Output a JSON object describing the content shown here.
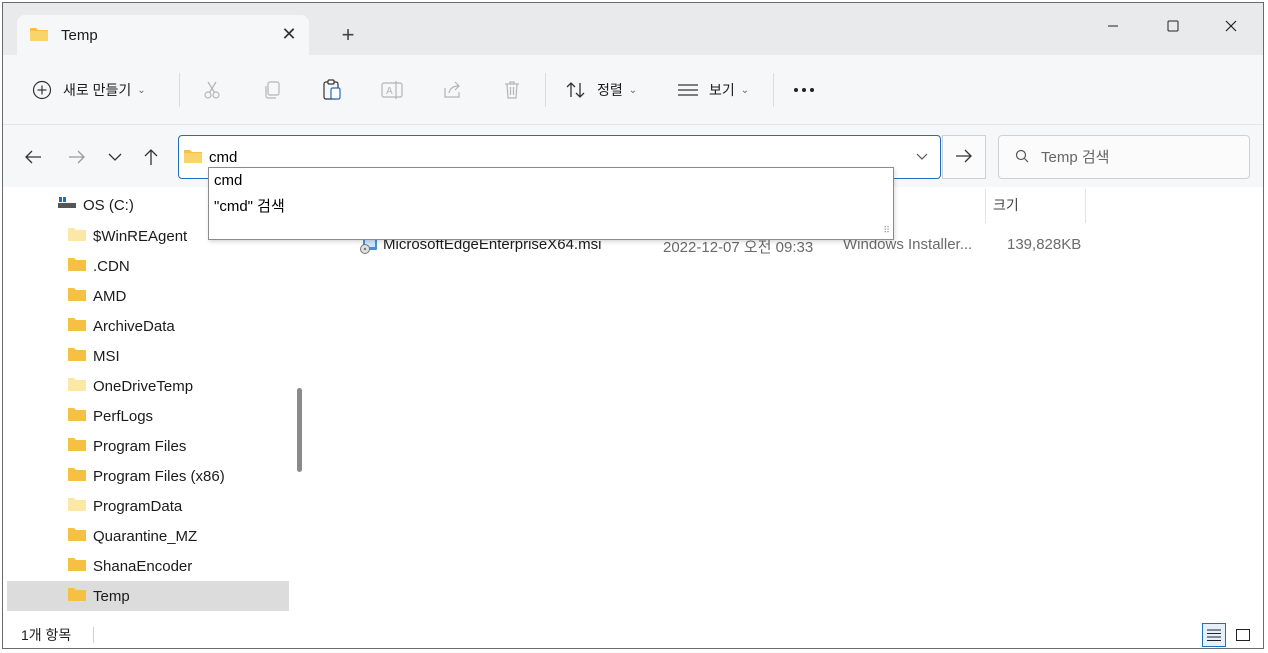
{
  "colors": {
    "accent": "#1f6fbf",
    "folder": "#f6c143",
    "folder_light": "#fbe7a6",
    "selected_bg": "#dcdcdc",
    "titlebar_bg": "#e9eaec"
  },
  "tab": {
    "title": "Temp",
    "close_icon": "close-icon",
    "new_tab_icon": "plus-icon"
  },
  "window_controls": {
    "minimize": "minimize-icon",
    "maximize": "maximize-icon",
    "close": "close-icon"
  },
  "toolbar": {
    "new_label": "새로 만들기",
    "sort_label": "정렬",
    "view_label": "보기",
    "more_icon": "more-icon",
    "action_icons": [
      "cut-icon",
      "copy-icon",
      "paste-icon",
      "rename-icon",
      "share-icon",
      "delete-icon"
    ]
  },
  "address": {
    "value": "cmd"
  },
  "search": {
    "placeholder": "Temp 검색"
  },
  "suggestions": [
    "cmd",
    "\"cmd\" 검색"
  ],
  "sidebar": {
    "drive": "OS (C:)",
    "items": [
      {
        "label": "$WinREAgent",
        "icon": "folder-light"
      },
      {
        "label": ".CDN",
        "icon": "folder"
      },
      {
        "label": "AMD",
        "icon": "folder"
      },
      {
        "label": "ArchiveData",
        "icon": "folder"
      },
      {
        "label": "MSI",
        "icon": "folder"
      },
      {
        "label": "OneDriveTemp",
        "icon": "folder-light"
      },
      {
        "label": "PerfLogs",
        "icon": "folder"
      },
      {
        "label": "Program Files",
        "icon": "folder"
      },
      {
        "label": "Program Files (x86)",
        "icon": "folder"
      },
      {
        "label": "ProgramData",
        "icon": "folder-light"
      },
      {
        "label": "Quarantine_MZ",
        "icon": "folder"
      },
      {
        "label": "ShanaEncoder",
        "icon": "folder"
      },
      {
        "label": "Temp",
        "icon": "folder",
        "selected": true
      }
    ]
  },
  "columns": {
    "size": "크기"
  },
  "files": [
    {
      "name": "MicrosoftEdgeEnterpriseX64.msi",
      "date": "2022-12-07 오전 09:33",
      "type": "Windows Installer...",
      "size": "139,828KB"
    }
  ],
  "status": {
    "count": "1개 항목"
  }
}
